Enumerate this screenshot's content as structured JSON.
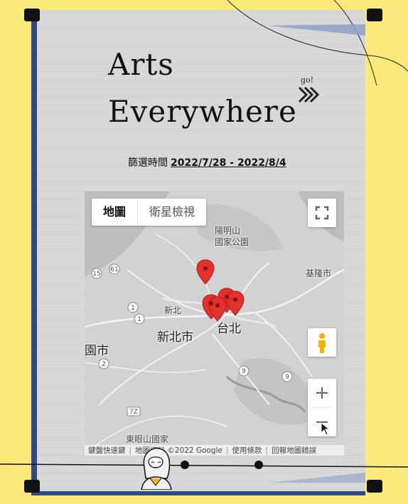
{
  "title": {
    "line1": "Arts",
    "line2": "Everywhere"
  },
  "go": {
    "text": "go!",
    "arrows": "»"
  },
  "filter": {
    "label": "篩選時間",
    "range": "2022/7/28 - 2022/8/4"
  },
  "map": {
    "type_tabs": [
      "地圖",
      "衛星檢視"
    ],
    "labels": {
      "yangmingshan": "陽明山",
      "national_park": "國家公園",
      "keelung": "基隆市",
      "xinbei_small": "新北",
      "xinbei_city": "新北市",
      "taipei": "台北",
      "taoyuan": "園市",
      "dongyan": "東眼山國家"
    },
    "road_numbers": [
      "15",
      "61",
      "1",
      "1",
      "2",
      "9",
      "9",
      "7Z"
    ],
    "zoom_in": "+",
    "zoom_out": "−",
    "attribution": {
      "shortcuts": "鍵盤快速鍵",
      "map_data": "地圖資料 ©2022 Google",
      "terms": "使用條款",
      "report": "回報地圖錯誤"
    },
    "marker_color": "#e3322b"
  },
  "colors": {
    "background": "#fbe97a",
    "accent_blue": "#2f4b86",
    "poster": "#d9d9d9"
  },
  "icons": [
    "fullscreen-icon",
    "pegman-icon",
    "map-marker-icon",
    "chevron-double-right-icon",
    "avatar-icon"
  ]
}
